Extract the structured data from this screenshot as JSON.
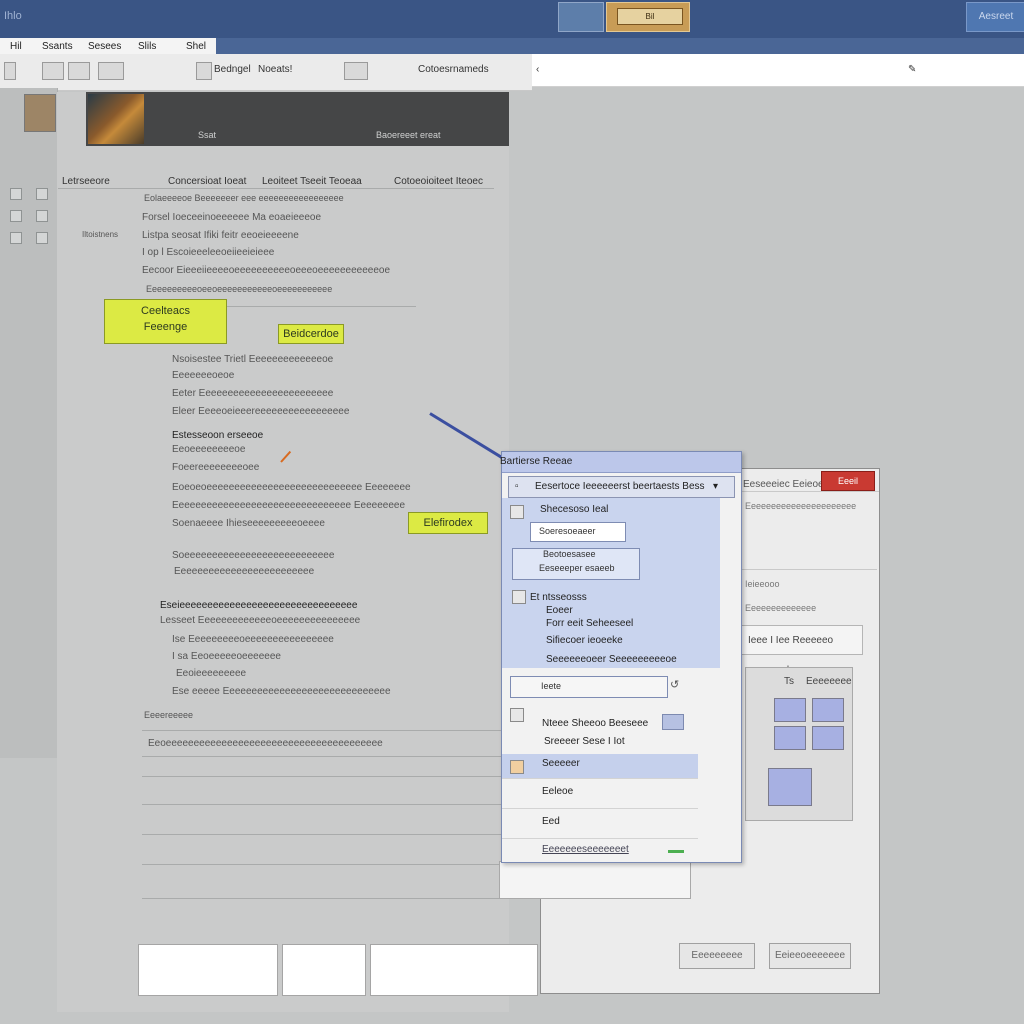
{
  "titlebar": {
    "left_text": "Ihlo",
    "tab_label": "Bil",
    "right_button": "Aesreet"
  },
  "menu": {
    "items": [
      "Hil",
      "Ssants",
      "Sesees",
      "Slils",
      "Shel"
    ]
  },
  "toolbar": {
    "items": [
      "Bedngel",
      "Noeats!",
      "Cotoesrnameds"
    ]
  },
  "document": {
    "banner_text1": "Ssat",
    "banner_text2": "Baoereeet ereat",
    "toc_header_left": "Letrseeore",
    "toc_header_mid": "Concersioat Ioeat",
    "toc_header_mid2": "Leoiteet Tseeit Teoeaa",
    "toc_header_right": "Cotoeoioiteet Iteoec",
    "side_label": "Iltoistnens",
    "rows": [
      "Eolaeeeeoe Beeeeeeer eee eeeeeeeeeeeeeeeee",
      "Forsel Ioeceeinoeeeeee Ma eoaeieeeoe",
      "Listpa seosat Ifiki feitr eeoeieeeene",
      "I op l Escoieeeleeoeiieeieieee",
      "Eecoor Eieeeiieeeeoeeeeeeeeeeoeeeoeeeeeeeeeeeoe",
      "Eeeeeeeeeeoeeoeeeeeeeeeeeoeeeeeeeeeee",
      "Nsoisestee Trietl Eeeeeeeeeeeeeoe",
      "Eeeeeeeoeoe",
      "Eeter Eeeeeeeeeeeeeeeeeeeeeeee",
      "Eleer Eeeeoeieeereeeeeeeeeeeeeeeee",
      "Estesseoon erseeoe",
      "Eeoeeeeeeeeoe",
      "Foeereeeeeeeeoee",
      "Eoeoeoeeeeeeeeeeeeeeeeeeeeeeeeeeee Eeeeeeee",
      "Eeeeeeeeeeeeeeeeeeeeeeeeeeeeeeee Eeeeeeeee",
      "Soenaeeee Ihieseeeeeeeeeoeeee",
      "Soeeeeeeeeeeeeeeeeeeeeeeeeeee",
      "Eeeeeeeeeeeeeeeeeeeeeeeee",
      "Eseieeeeeeeeeeeeeeeeeeeeeeeeeeeeeeee",
      "Lesseet Eeeeeeeeeeeeeoeeeeeeeeeeeeeee",
      "Ise Eeeeeeeeeoeeeeeeeeeeeeeeee",
      "I sa Eeoeeeeeoeeeeeee",
      "Eeoieeeeeeeee",
      "Ese eeeee Eeeeeeeeeeeeeeeeeeeeeeeeeeeeee",
      "Eeeereeeee",
      "Eeoeeeeeeeeeeeeeeeeeeeeeeeeeeeeeeeeeeeeeee"
    ]
  },
  "callouts": {
    "c1_line1": "Ceelteacs",
    "c1_line2": "Feeenge",
    "c2": "Beidcerdoe",
    "c3": "Elefirodex"
  },
  "popup": {
    "title": "Bartierse Reeae",
    "search_bar": "Eesertoce Ieeeeeerst beertaests Bess",
    "item1": "Shecesoso Ieal",
    "item2": "Soeresoeaeer",
    "item3": "Beotoesasee",
    "item4": "Eeseeeper esaeeb",
    "section_head": "Et ntsseosss",
    "sub1": "Eoeer",
    "sub2": "Forr eeit Seheeseel",
    "sub3": "Sifiecoer ieoeeke",
    "sub4": "Seeeeeeoeer Seeeeeeeeeoe",
    "list1": "Ieete",
    "list2": "Nteee Sheeoo Beeseee",
    "list3": "Sreeeer Sese I Iot",
    "list4": "Seeeeer",
    "list5": "Eeleoe",
    "list6": "Eed",
    "footer": "Eeeeeeeseeeeeeet"
  },
  "dialog": {
    "title": "Eeseeeiec  Eeieoe",
    "close": "Eeeil",
    "row1": "Eeeeeeeeeeeeeeeeeeeeee",
    "row2": "Ieieeooo",
    "row3": "Eeeeeeeeeeeeee",
    "textbox": "Ieee I Iee Reeeeeo eeeeeeel",
    "thumb_num": "Ts",
    "thumb_label": "Eeeeeeee",
    "button_left": "Eeeeeeeee",
    "button_right": "Eeieeoeeeeeee"
  }
}
